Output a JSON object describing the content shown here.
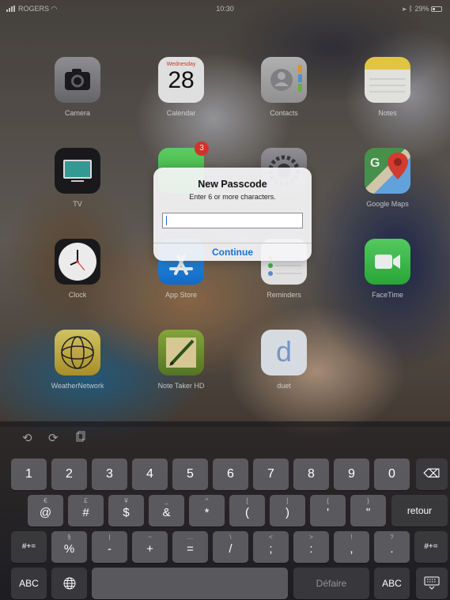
{
  "status_bar": {
    "carrier": "ROGERS",
    "time": "10:30",
    "battery": "29%"
  },
  "home": {
    "apps": [
      {
        "name": "Camera"
      },
      {
        "name": "Calendar",
        "weekday": "Wednesday",
        "day": "28"
      },
      {
        "name": "Contacts"
      },
      {
        "name": "Notes"
      },
      {
        "name": "TV"
      },
      {
        "name": "",
        "badge": "3"
      },
      {
        "name": ""
      },
      {
        "name": "Google Maps"
      },
      {
        "name": "Clock"
      },
      {
        "name": "App Store"
      },
      {
        "name": "Reminders"
      },
      {
        "name": "FaceTime"
      },
      {
        "name": "WeatherNetwork"
      },
      {
        "name": "Note Taker HD"
      },
      {
        "name": "duet",
        "glyph": "d"
      }
    ]
  },
  "alert": {
    "title": "New Passcode",
    "message": "Enter 6 or more characters.",
    "input_value": "",
    "continue_label": "Continue"
  },
  "keyboard": {
    "toolbar": {
      "undo_icon": "undo-icon",
      "redo_icon": "redo-icon",
      "paste_icon": "paste-icon"
    },
    "row1": [
      {
        "label": "1"
      },
      {
        "label": "2"
      },
      {
        "label": "3"
      },
      {
        "label": "4"
      },
      {
        "label": "5"
      },
      {
        "label": "6"
      },
      {
        "label": "7"
      },
      {
        "label": "8"
      },
      {
        "label": "9"
      },
      {
        "label": "0"
      }
    ],
    "backspace_icon": "⌫",
    "row2": [
      {
        "sub": "€",
        "label": "@"
      },
      {
        "sub": "£",
        "label": "#"
      },
      {
        "sub": "¥",
        "label": "$"
      },
      {
        "sub": "_",
        "label": "&"
      },
      {
        "sub": "^",
        "label": "*"
      },
      {
        "sub": "[",
        "label": "("
      },
      {
        "sub": "]",
        "label": ")"
      },
      {
        "sub": "{",
        "label": "'"
      },
      {
        "sub": "}",
        "label": "\""
      }
    ],
    "return_label": "retour",
    "shift_label": "#+=",
    "row3": [
      {
        "sub": "§",
        "label": "%"
      },
      {
        "sub": "|",
        "label": "-"
      },
      {
        "sub": "~",
        "label": "+"
      },
      {
        "sub": "…",
        "label": "="
      },
      {
        "sub": "\\",
        "label": "/"
      },
      {
        "sub": "<",
        "label": ";"
      },
      {
        "sub": ">",
        "label": ":"
      },
      {
        "sub": "!",
        "label": ","
      },
      {
        "sub": "?",
        "label": "."
      }
    ],
    "abc_label": "ABC",
    "globe_icon": "globe-icon",
    "space_label": "",
    "default_label": "Défaire",
    "hide_keyboard_icon": "keyboard-dismiss-icon"
  }
}
